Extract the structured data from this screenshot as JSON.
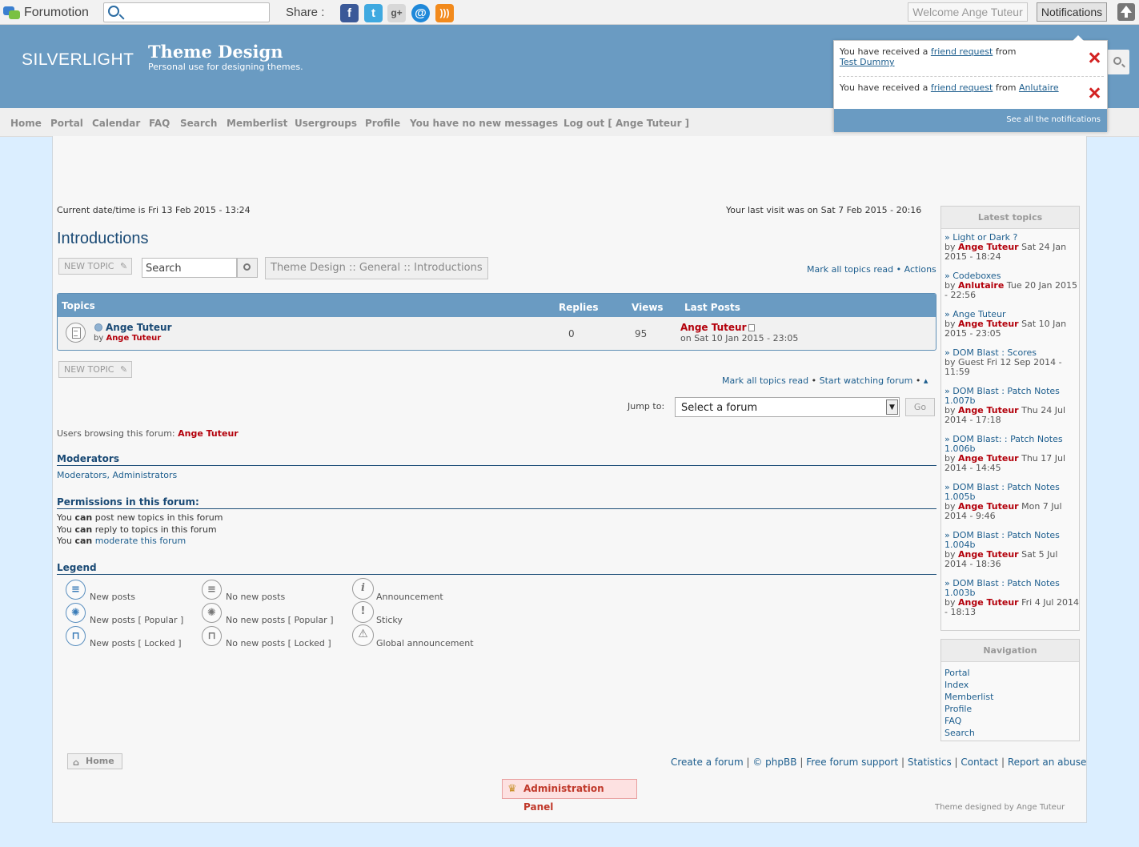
{
  "toolbar": {
    "logo": "Forumotion",
    "search_placeholder": "",
    "share_label": "Share :",
    "share_icons": [
      "facebook-icon",
      "twitter-icon",
      "google-plus-icon",
      "email-icon",
      "rss-icon"
    ],
    "welcome": "Welcome Ange Tuteur",
    "notifications": "Notifications"
  },
  "header": {
    "logo": "SILVERLIGHT",
    "title": "Theme Design",
    "description": "Personal use for designing themes."
  },
  "nav": [
    "Home",
    "Portal",
    "Calendar",
    "FAQ",
    "Search",
    "Memberlist",
    "Usergroups",
    "Profile",
    "You have no new messages",
    "Log out [ Ange Tuteur ]"
  ],
  "notifications_popup": {
    "items": [
      {
        "prefix": "You have received a ",
        "link": "friend request",
        "mid": " from",
        "user": "Test Dummy"
      },
      {
        "prefix": "You have received a ",
        "link": "friend request",
        "mid": " from ",
        "user": "Anlutaire"
      }
    ],
    "see_all": "See all the notifications"
  },
  "page": {
    "current_time": "Current date/time is Fri 13 Feb 2015 - 13:24",
    "last_visit": "Your last visit was on Sat 7 Feb 2015 - 20:16",
    "forum_title": "Introductions",
    "new_topic": "NEW TOPIC",
    "search_value": "Search",
    "breadcrumb": "Theme Design :: General :: Introductions",
    "mark_all_read": "Mark all topics read",
    "bullet": "•",
    "actions": "Actions",
    "start_watching": "Start watching forum",
    "jump_to": "Jump to:",
    "jump_select": "Select a forum",
    "go": "Go",
    "users_browsing_label": "Users browsing this forum:",
    "users_browsing_user": "Ange Tuteur"
  },
  "topics_table": {
    "headers": {
      "topics": "Topics",
      "replies": "Replies",
      "views": "Views",
      "last_posts": "Last Posts"
    },
    "rows": [
      {
        "title": "Ange Tuteur",
        "by": "by",
        "author": "Ange Tuteur",
        "replies": "0",
        "views": "95",
        "last_author": "Ange Tuteur",
        "last_date": "on Sat 10 Jan 2015 - 23:05"
      }
    ]
  },
  "moderators": {
    "heading": "Moderators",
    "value": "Moderators, Administrators"
  },
  "permissions": {
    "heading": "Permissions in this forum:",
    "lines": [
      {
        "a": "You ",
        "b": "can",
        "c": " post new topics in this forum",
        "link": ""
      },
      {
        "a": "You ",
        "b": "can",
        "c": " reply to topics in this forum",
        "link": ""
      },
      {
        "a": "You ",
        "b": "can",
        "c": " ",
        "link": "moderate this forum"
      }
    ]
  },
  "legend": {
    "heading": "Legend",
    "items": [
      "New posts",
      "New posts [ Popular ]",
      "New posts [ Locked ]",
      "No new posts",
      "No new posts [ Popular ]",
      "No new posts [ Locked ]",
      "Announcement",
      "Sticky",
      "Global announcement"
    ]
  },
  "latest_topics": {
    "heading": "Latest topics",
    "items": [
      {
        "title": "» Light or Dark ?",
        "pre": "by ",
        "user": "Ange Tuteur",
        "post": " Sat 24 Jan 2015 - 18:24"
      },
      {
        "title": "» Codeboxes",
        "pre": "by ",
        "user": "Anlutaire",
        "post": " Tue 20 Jan 2015 - 22:56"
      },
      {
        "title": "» Ange Tuteur",
        "pre": "by ",
        "user": "Ange Tuteur",
        "post": " Sat 10 Jan 2015 - 23:05"
      },
      {
        "title": "» DOM Blast : Scores",
        "pre": "by Guest Fri 12 Sep 2014 - 11:59",
        "user": "",
        "post": ""
      },
      {
        "title": "» DOM Blast : Patch Notes 1.007b",
        "pre": "by ",
        "user": "Ange Tuteur",
        "post": " Thu 24 Jul 2014 - 17:18"
      },
      {
        "title": "» DOM Blast: : Patch Notes 1.006b",
        "pre": "by ",
        "user": "Ange Tuteur",
        "post": " Thu 17 Jul 2014 - 14:45"
      },
      {
        "title": "» DOM Blast : Patch Notes 1.005b",
        "pre": "by ",
        "user": "Ange Tuteur",
        "post": " Mon 7 Jul 2014 - 9:46"
      },
      {
        "title": "» DOM Blast : Patch Notes 1.004b",
        "pre": "by ",
        "user": "Ange Tuteur",
        "post": " Sat 5 Jul 2014 - 18:36"
      },
      {
        "title": "» DOM Blast : Patch Notes 1.003b",
        "pre": "by ",
        "user": "Ange Tuteur",
        "post": " Fri 4 Jul 2014 - 18:13"
      }
    ]
  },
  "navigation_widget": {
    "heading": "Navigation",
    "items": [
      "Portal",
      "Index",
      "Memberlist",
      "Profile",
      "FAQ",
      "Search"
    ]
  },
  "footer": {
    "home": "Home",
    "links": [
      "Create a forum",
      "© phpBB",
      "Free forum support",
      "Statistics",
      "Contact",
      "Report an abuse"
    ],
    "separator": "|",
    "admin_panel": "Administration Panel",
    "credit": "Theme designed by Ange Tuteur"
  }
}
